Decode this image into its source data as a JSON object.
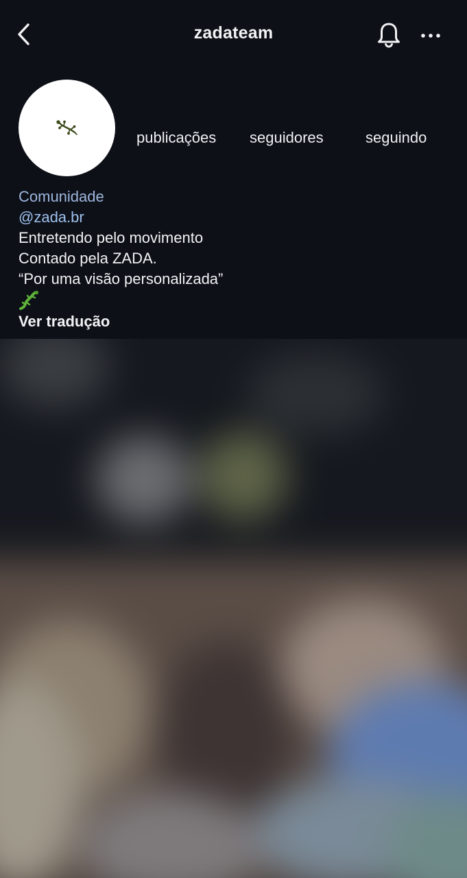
{
  "header": {
    "title": "zadateam",
    "back_icon": "chevron-left-icon",
    "bell_icon": "bell-icon",
    "more_icon": "more-horizontal-icon"
  },
  "profile": {
    "avatar_icon": "gecko-logo-icon",
    "stats": [
      {
        "label": "publicações"
      },
      {
        "label": "seguidores"
      },
      {
        "label": "seguindo"
      }
    ]
  },
  "bio": {
    "category": "Comunidade",
    "handle": "@zada.br",
    "lines": [
      "Entretendo pelo movimento",
      "Contado pela ZADA.",
      "“Por uma visão personalizada”"
    ],
    "emoji": "🦎",
    "translate_label": "Ver tradução"
  },
  "colors": {
    "background": "#0d1017",
    "text": "#f2f3f5",
    "link": "#9fc0ee",
    "category": "#9fb6de"
  }
}
